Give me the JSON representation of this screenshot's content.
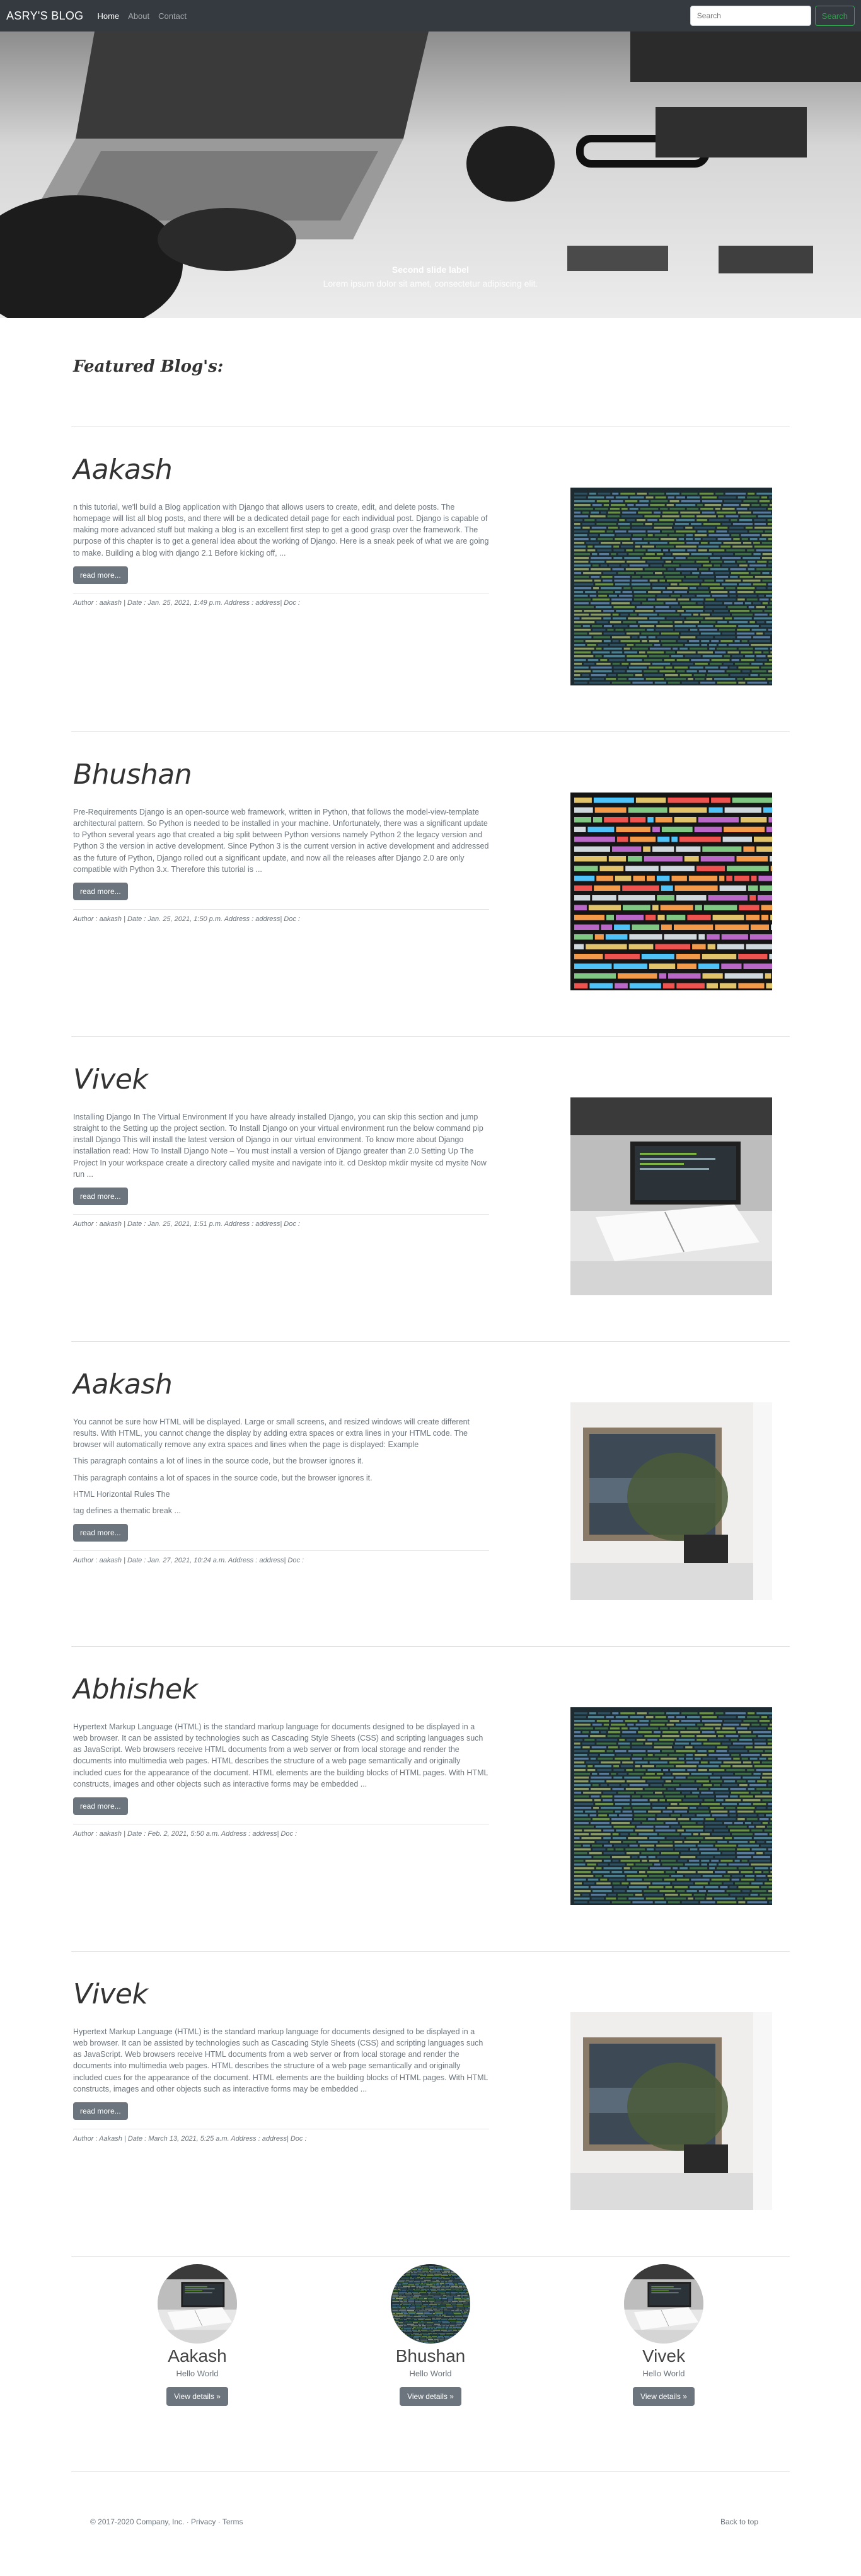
{
  "nav": {
    "brand": "ASRY'S BLOG",
    "links": [
      "Home",
      "About",
      "Contact"
    ],
    "search_placeholder": "Search",
    "search_button": "Search"
  },
  "hero": {
    "caption_title": "Second slide label",
    "caption_text": "Lorem ipsum dolor sit amet, consectetur adipiscing elit."
  },
  "featured_heading": "Featured Blog's:",
  "posts": [
    {
      "title": "Aakash",
      "paragraphs": [
        "n this tutorial, we'll build a Blog application with Django that allows users to create, edit, and delete posts. The homepage will list all blog posts, and there will be a dedicated detail page for each individual post. Django is capable of making more advanced stuff but making a blog is an excellent first step to get a good grasp over the framework. The purpose of this chapter is to get a general idea about the working of Django. Here is a sneak peek of what we are going to make. Building a blog with django 2.1 Before kicking off, ..."
      ],
      "button": "read more...",
      "meta": "Author : aakash | Date : Jan. 25, 2021, 1:49 p.m. Address : address| Doc :",
      "image": "code-screen"
    },
    {
      "title": "Bhushan",
      "paragraphs": [
        "Pre-Requirements Django is an open-source web framework, written in Python, that follows the model-view-template architectural pattern. So Python is needed to be installed in your machine. Unfortunately, there was a significant update to Python several years ago that created a big split between Python versions namely Python 2 the legacy version and Python 3 the version in active development. Since Python 3 is the current version in active development and addressed as the future of Python, Django rolled out a significant update, and now all the releases after Django 2.0 are only compatible with Python 3.x. Therefore this tutorial is ..."
      ],
      "button": "read more...",
      "meta": "Author : aakash | Date : Jan. 25, 2021, 1:50 p.m. Address : address| Doc :",
      "image": "code-closeup"
    },
    {
      "title": "Vivek",
      "paragraphs": [
        "Installing Django In The Virtual Environment If you have already installed Django, you can skip this section and jump straight to the Setting up the project section. To Install Django on your virtual environment run the below command pip install Django This will install the latest version of Django in our virtual environment. To know more about Django installation read: How To Install Django Note – You must install a version of Django greater than 2.0 Setting Up The Project In your workspace create a directory called mysite and navigate into it. cd Desktop mkdir mysite cd mysite Now run ..."
      ],
      "button": "read more...",
      "meta": "Author : aakash | Date : Jan. 25, 2021, 1:51 p.m. Address : address| Doc :",
      "image": "laptop-book"
    },
    {
      "title": "Aakash",
      "paragraphs": [
        "You cannot be sure how HTML will be displayed. Large or small screens, and resized windows will create different results. With HTML, you cannot change the display by adding extra spaces or extra lines in your HTML code. The browser will automatically remove any extra spaces and lines when the page is displayed: Example",
        "This paragraph contains a lot of lines in the source code, but the browser ignores it.",
        "This paragraph contains a lot of spaces in the source code, but the browser ignores it.",
        "HTML Horizontal Rules The",
        "tag defines a thematic break ..."
      ],
      "button": "read more...",
      "meta": "Author : aakash | Date : Jan. 27, 2021, 10:24 a.m. Address : address| Doc :",
      "image": "room-plant"
    },
    {
      "title": "Abhishek",
      "paragraphs": [
        "Hypertext Markup Language (HTML) is the standard markup language for documents designed to be displayed in a web browser. It can be assisted by technologies such as Cascading Style Sheets (CSS) and scripting languages such as JavaScript. Web browsers receive HTML documents from a web server or from local storage and render the documents into multimedia web pages. HTML describes the structure of a web page semantically and originally included cues for the appearance of the document. HTML elements are the building blocks of HTML pages. With HTML constructs, images and other objects such as interactive forms may be embedded ..."
      ],
      "button": "read more...",
      "meta": "Author : aakash | Date : Feb. 2, 2021, 5:50 a.m. Address : address| Doc :",
      "image": "code-screen"
    },
    {
      "title": "Vivek",
      "paragraphs": [
        "Hypertext Markup Language (HTML) is the standard markup language for documents designed to be displayed in a web browser. It can be assisted by technologies such as Cascading Style Sheets (CSS) and scripting languages such as JavaScript. Web browsers receive HTML documents from a web server or from local storage and render the documents into multimedia web pages. HTML describes the structure of a web page semantically and originally included cues for the appearance of the document. HTML elements are the building blocks of HTML pages. With HTML constructs, images and other objects such as interactive forms may be embedded ..."
      ],
      "button": "read more...",
      "meta": "Author : Aakash | Date : March 13, 2021, 5:25 a.m. Address : address| Doc :",
      "image": "room-plant"
    }
  ],
  "authors": [
    {
      "name": "Aakash",
      "desc": "Hello World",
      "button": "View details »",
      "image": "laptop-book"
    },
    {
      "name": "Bhushan",
      "desc": "Hello World",
      "button": "View details »",
      "image": "code-screen"
    },
    {
      "name": "Vivek",
      "desc": "Hello World",
      "button": "View details »",
      "image": "laptop-book"
    }
  ],
  "footer": {
    "copyright": "© 2017-2020 Company, Inc. · Privacy · Terms",
    "back_to_top": "Back to top"
  }
}
